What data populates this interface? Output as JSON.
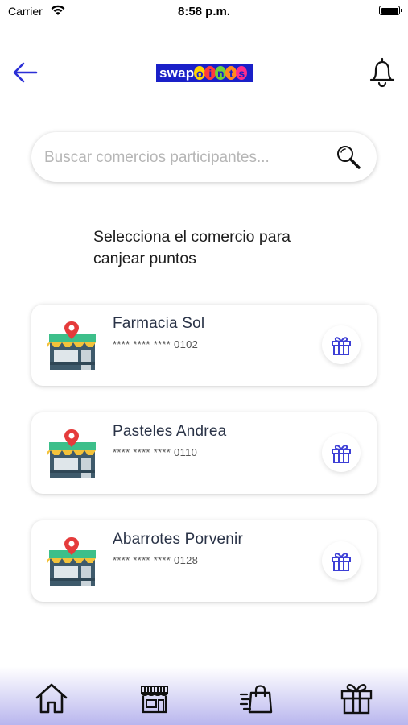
{
  "status_bar": {
    "carrier": "Carrier",
    "time": "8:58 p.m."
  },
  "header": {
    "logo": {
      "part1": "swap",
      "letters": [
        "o",
        "i",
        "n",
        "t",
        "s"
      ],
      "letter_colors": [
        "#ffd400",
        "#ff3b3b",
        "#6fd13a",
        "#ff8a1c",
        "#ff2d8a"
      ]
    },
    "back_icon": "arrow-left-icon",
    "bell_icon": "bell-icon"
  },
  "search": {
    "placeholder": "Buscar comercios participantes...",
    "value": "",
    "icon": "magnifier-icon"
  },
  "instruction": {
    "line1": "Selecciona el comercio para",
    "line2": "canjear puntos"
  },
  "merchants": [
    {
      "name": "Farmacia Sol",
      "number": "**** **** **** 0102"
    },
    {
      "name": "Pasteles Andrea",
      "number": "**** **** **** 0110"
    },
    {
      "name": "Abarrotes Porvenir",
      "number": "**** **** **** 0128"
    }
  ],
  "tab_bar": {
    "tabs": [
      "home-icon",
      "store-icon",
      "shopping-bag-icon",
      "gift-icon"
    ]
  },
  "colors": {
    "accent": "#2b2fd6",
    "logo_bg": "#1a20c8",
    "gift": "#3d3fd6"
  }
}
